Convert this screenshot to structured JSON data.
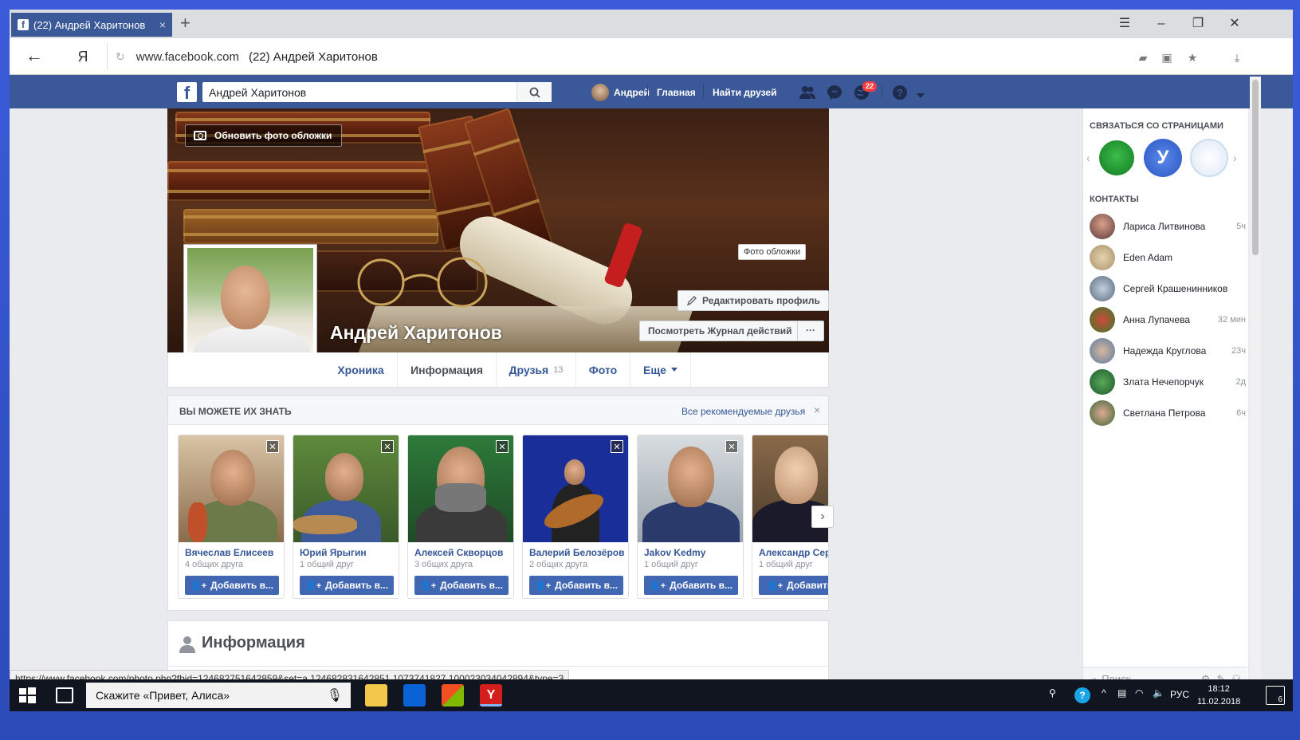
{
  "browser": {
    "tab_title": "(22) Андрей Харитонов",
    "tab_close": "×",
    "new_tab": "+",
    "address_host": "www.facebook.com",
    "address_title": "(22) Андрей Харитонов",
    "yandex_label": "Я"
  },
  "fb_header": {
    "search_value": "Андрей Харитонов",
    "user_name": "Андрей",
    "home_label": "Главная",
    "find_friends_label": "Найти друзей",
    "notification_count": "22"
  },
  "profile": {
    "name": "Андрей Харитонов",
    "update_cover_label": "Обновить фото обложки",
    "cover_tooltip": "Фото обложки",
    "edit_profile_label": "Редактировать профиль",
    "activity_log_label": "Посмотреть Журнал действий",
    "more_label": "···",
    "tabs": [
      {
        "label": "Хроника"
      },
      {
        "label": "Информация"
      },
      {
        "label": "Друзья",
        "count": "13"
      },
      {
        "label": "Фото"
      },
      {
        "label": "Еще"
      }
    ]
  },
  "pymk": {
    "title": "ВЫ МОЖЕТЕ ИХ ЗНАТЬ",
    "all_link": "Все рекомендуемые друзья",
    "close": "×",
    "add_label": "Добавить в...",
    "people": [
      {
        "name": "Вячеслав Елисеев",
        "mutual": "4 общих друга"
      },
      {
        "name": "Юрий Ярыгин",
        "mutual": "1 общий друг"
      },
      {
        "name": "Алексей Скворцов",
        "mutual": "3 общих друга"
      },
      {
        "name": "Валерий Белозёров",
        "mutual": "2 общих друга"
      },
      {
        "name": "Jakov Kedmy",
        "mutual": "1 общий друг"
      },
      {
        "name": "Александр Сер",
        "mutual": "1 общий друг"
      }
    ],
    "next": "›"
  },
  "info_section": {
    "title": "Информация"
  },
  "status_url": "https://www.facebook.com/photo.php?fbid=124682751642859&set=a.124682831642851.1073741827.100023034042894&type=3",
  "sidebar": {
    "pages_title": "СВЯЗАТЬСЯ СО СТРАНИЦАМИ",
    "contacts_title": "КОНТАКТЫ",
    "search_placeholder": "Поиск",
    "contacts": [
      {
        "name": "Лариса Литвинова",
        "time": "5ч"
      },
      {
        "name": "Eden Adam",
        "time": ""
      },
      {
        "name": "Сергей Крашенинников",
        "time": ""
      },
      {
        "name": "Анна Лупачева",
        "time": "32 мин"
      },
      {
        "name": "Надежда Круглова",
        "time": "23ч"
      },
      {
        "name": "Злата Нечепорчук",
        "time": "2д"
      },
      {
        "name": "Светлана Петрова",
        "time": "6ч"
      }
    ]
  },
  "taskbar": {
    "search_text": "Скажите «Привет, Алиса»",
    "lang": "РУС",
    "time": "18:12",
    "date": "11.02.2018",
    "notif_count": "6"
  },
  "colors": {
    "fb_blue": "#3b5998",
    "button_blue": "#4267b2",
    "link_blue": "#365899",
    "page_bg": "#e9ebee"
  }
}
